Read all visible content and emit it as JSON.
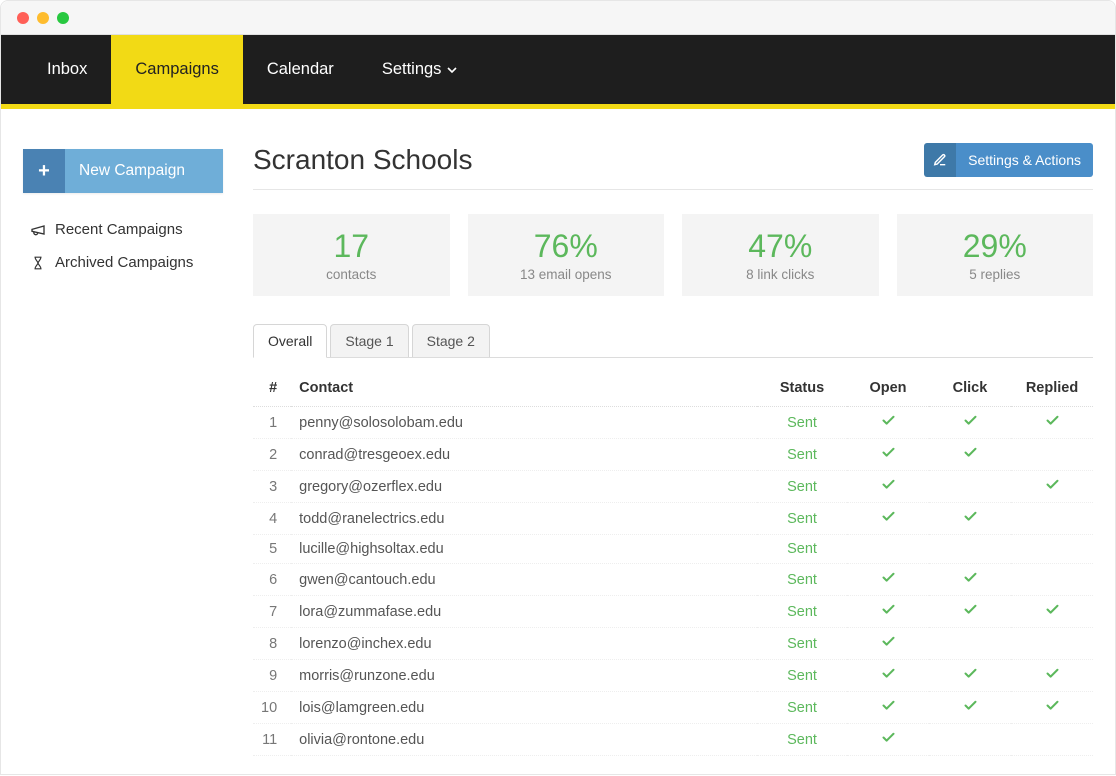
{
  "nav": {
    "items": [
      {
        "label": "Inbox",
        "active": false,
        "has_caret": false
      },
      {
        "label": "Campaigns",
        "active": true,
        "has_caret": false
      },
      {
        "label": "Calendar",
        "active": false,
        "has_caret": false
      },
      {
        "label": "Settings",
        "active": false,
        "has_caret": true
      }
    ]
  },
  "sidebar": {
    "new_campaign_label": "New Campaign",
    "links": [
      {
        "label": "Recent Campaigns",
        "icon": "megaphone"
      },
      {
        "label": "Archived Campaigns",
        "icon": "hourglass"
      }
    ]
  },
  "header": {
    "title": "Scranton Schools",
    "settings_actions_label": "Settings & Actions"
  },
  "stats": [
    {
      "value": "17",
      "label": "contacts"
    },
    {
      "value": "76%",
      "label": "13 email opens"
    },
    {
      "value": "47%",
      "label": "8 link clicks"
    },
    {
      "value": "29%",
      "label": "5 replies"
    }
  ],
  "tabs": [
    {
      "label": "Overall",
      "active": true
    },
    {
      "label": "Stage 1",
      "active": false
    },
    {
      "label": "Stage 2",
      "active": false
    }
  ],
  "table": {
    "headers": {
      "index": "#",
      "contact": "Contact",
      "status": "Status",
      "open": "Open",
      "click": "Click",
      "replied": "Replied"
    },
    "rows": [
      {
        "n": 1,
        "contact": "penny@solosolobam.edu",
        "status": "Sent",
        "open": true,
        "click": true,
        "replied": true
      },
      {
        "n": 2,
        "contact": "conrad@tresgeoex.edu",
        "status": "Sent",
        "open": true,
        "click": true,
        "replied": false
      },
      {
        "n": 3,
        "contact": "gregory@ozerflex.edu",
        "status": "Sent",
        "open": true,
        "click": false,
        "replied": true
      },
      {
        "n": 4,
        "contact": "todd@ranelectrics.edu",
        "status": "Sent",
        "open": true,
        "click": true,
        "replied": false
      },
      {
        "n": 5,
        "contact": "lucille@highsoltax.edu",
        "status": "Sent",
        "open": false,
        "click": false,
        "replied": false
      },
      {
        "n": 6,
        "contact": "gwen@cantouch.edu",
        "status": "Sent",
        "open": true,
        "click": true,
        "replied": false
      },
      {
        "n": 7,
        "contact": "lora@zummafase.edu",
        "status": "Sent",
        "open": true,
        "click": true,
        "replied": true
      },
      {
        "n": 8,
        "contact": "lorenzo@inchex.edu",
        "status": "Sent",
        "open": true,
        "click": false,
        "replied": false
      },
      {
        "n": 9,
        "contact": "morris@runzone.edu",
        "status": "Sent",
        "open": true,
        "click": true,
        "replied": true
      },
      {
        "n": 10,
        "contact": "lois@lamgreen.edu",
        "status": "Sent",
        "open": true,
        "click": true,
        "replied": true
      },
      {
        "n": 11,
        "contact": "olivia@rontone.edu",
        "status": "Sent",
        "open": true,
        "click": false,
        "replied": false
      }
    ]
  }
}
